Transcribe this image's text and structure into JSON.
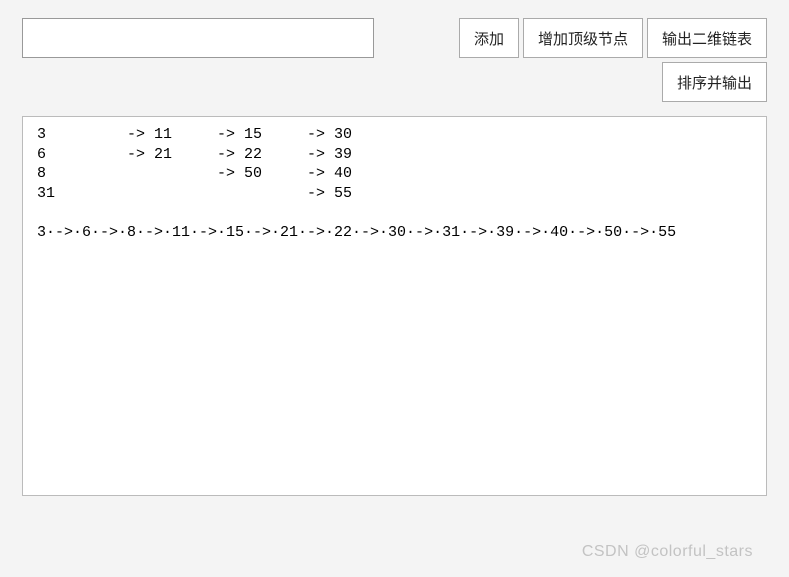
{
  "toolbar": {
    "input_value": "",
    "add_label": "添加",
    "add_top_label": "增加顶级节点",
    "output_2d_label": "输出二维链表",
    "sort_output_label": "排序并输出"
  },
  "output_text": "3         -> 11     -> 15     -> 30\n6         -> 21     -> 22     -> 39\n8                   -> 50     -> 40\n31                            -> 55\n\n3·->·6·->·8·->·11·->·15·->·21·->·22·->·30·->·31·->·39·->·40·->·50·->·55",
  "watermark": "CSDN @colorful_stars"
}
